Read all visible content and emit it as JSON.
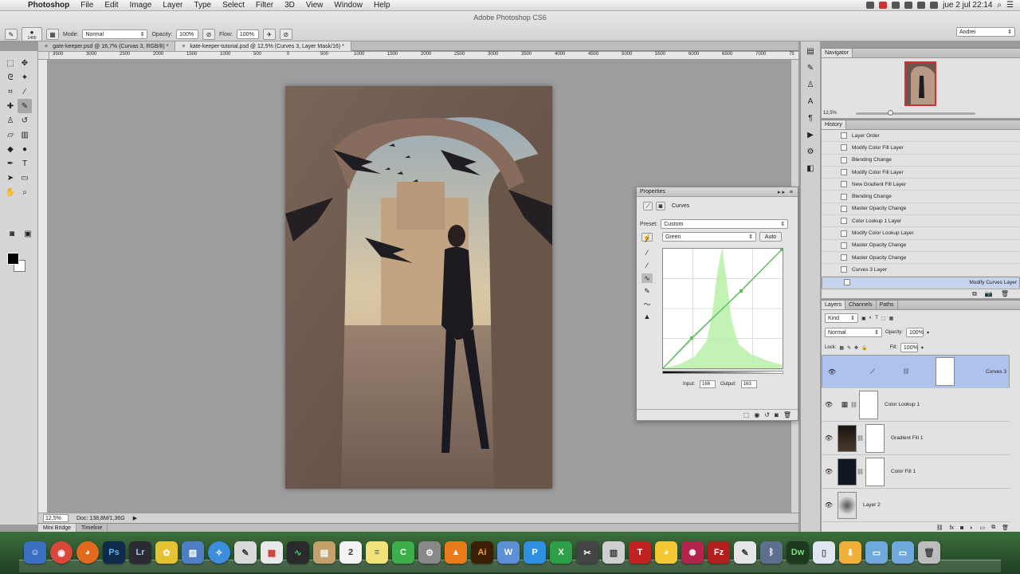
{
  "menubar": {
    "app": "Photoshop",
    "items": [
      "File",
      "Edit",
      "Image",
      "Layer",
      "Type",
      "Select",
      "Filter",
      "3D",
      "View",
      "Window",
      "Help"
    ],
    "clock": "jue 2 jul  22:14"
  },
  "window_title": "Adobe Photoshop CS6",
  "options": {
    "brush_size": "1400",
    "mode_label": "Mode:",
    "mode_value": "Normal",
    "opacity_label": "Opacity:",
    "opacity_value": "100%",
    "flow_label": "Flow:",
    "flow_value": "100%",
    "workspace": "Andrei"
  },
  "tabs": [
    {
      "label": "gate-keeper.psd @ 16,7% (Curvas 3, RGB/8) *",
      "active": false
    },
    {
      "label": "kate-keeper-tutorial.psd @ 12,5% (Curves 3, Layer Mask/16) *",
      "active": true
    }
  ],
  "ruler_ticks": [
    "3500",
    "3000",
    "2500",
    "2000",
    "1500",
    "1000",
    "500",
    "0",
    "500",
    "1000",
    "1500",
    "2000",
    "2500",
    "3000",
    "3500",
    "4000",
    "4500",
    "5000",
    "5500",
    "6000",
    "6500",
    "7000",
    "75"
  ],
  "status": {
    "zoom": "12,5%",
    "doc": "Doc: 138,8M/1,36G"
  },
  "bottom_tabs": [
    "Mini Bridge",
    "Timeline"
  ],
  "properties": {
    "panel_title": "Properties",
    "adjustment": "Curves",
    "preset_label": "Preset:",
    "preset_value": "Custom",
    "channel_value": "Green",
    "auto_label": "Auto",
    "input_label": "Input:",
    "input_value": "166",
    "output_label": "Output:",
    "output_value": "163"
  },
  "navigator": {
    "tab": "Navigator",
    "zoom": "12,5%"
  },
  "history": {
    "tab": "History",
    "items": [
      "Layer Order",
      "Modify Color Fill Layer",
      "Blending Change",
      "Modify Color Fill Layer",
      "New Gradient Fill Layer",
      "Blending Change",
      "Master Opacity Change",
      "Color Lookup 1 Layer",
      "Modify Color Lookup Layer",
      "Master Opacity Change",
      "Master Opacity Change",
      "Curves 3 Layer",
      "Modify Curves Layer"
    ]
  },
  "layers_panel": {
    "tabs": [
      "Layers",
      "Channels",
      "Paths"
    ],
    "kind": "Kind",
    "blend": "Normal",
    "opacity_label": "Opacity:",
    "opacity_value": "100%",
    "lock_label": "Lock:",
    "fill_label": "Fill:",
    "fill_value": "100%",
    "layers": [
      {
        "name": "Curves 3",
        "selected": true
      },
      {
        "name": "Color Lookup 1",
        "selected": false
      },
      {
        "name": "Gradient Fill 1",
        "selected": false
      },
      {
        "name": "Color Fill 1",
        "selected": false
      },
      {
        "name": "Layer 2",
        "selected": false
      }
    ]
  },
  "colors": {
    "accent_selection": "#aec2ee",
    "histogram": "#b8f0a8",
    "curve_line": "#5cc05c"
  }
}
